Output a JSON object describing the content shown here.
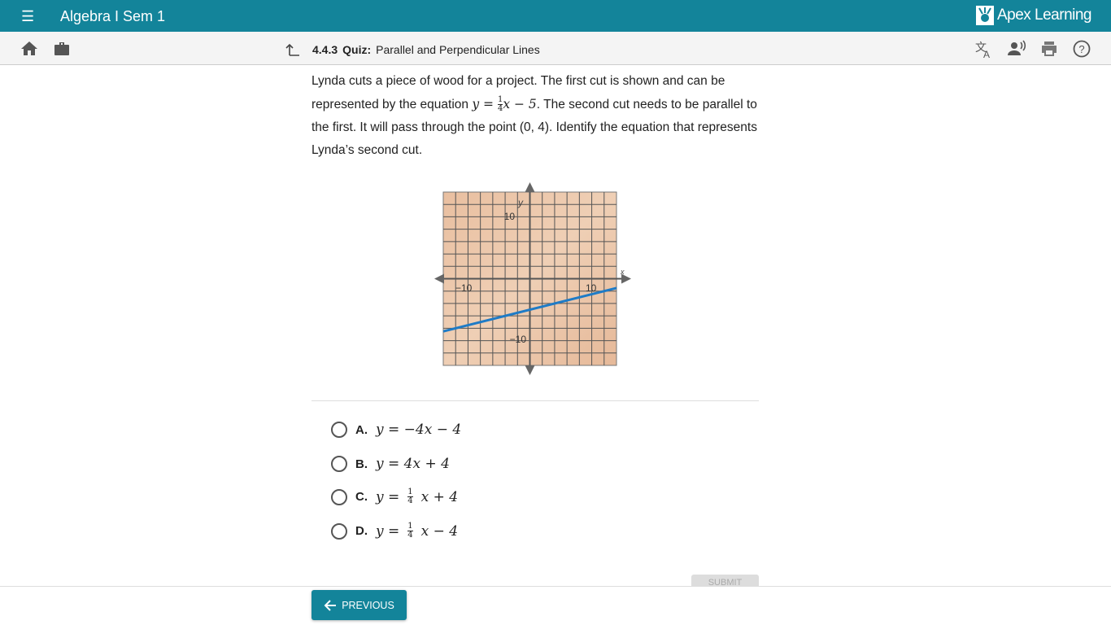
{
  "header": {
    "course_title": "Algebra I Sem 1",
    "brand": "Apex Learning",
    "brand_color": "#13849a"
  },
  "toolbar": {
    "lesson_number": "4.4.3",
    "lesson_type": "Quiz:",
    "lesson_title": "Parallel and Perpendicular Lines"
  },
  "question": {
    "part1": "Lynda cuts a piece of wood for a project. The first cut is shown and can be represented by the equation ",
    "eq_lhs": "y = ",
    "frac_num": "1",
    "frac_den": "4",
    "eq_rhs": "x − 5",
    "part2": ". The second cut needs to be parallel to the first. It will pass through the point (0, 4). Identify the equation that represents Lynda’s second cut."
  },
  "chart_data": {
    "type": "line",
    "xlabel": "x",
    "ylabel": "y",
    "xlim": [
      -14,
      14
    ],
    "ylim": [
      -14,
      14
    ],
    "grid": true,
    "grid_step": 2,
    "x_tick_labels": [
      "−10",
      "10"
    ],
    "y_tick_labels": [
      "10",
      "−10"
    ],
    "series": [
      {
        "equation": "y = 1/4 x − 5",
        "x": [
          -14,
          14
        ],
        "y": [
          -8.5,
          -1.5
        ],
        "color": "#1e7bc6"
      }
    ]
  },
  "options": [
    {
      "letter": "A.",
      "pre": "y = −4x − 4",
      "num": "",
      "den": "",
      "post": ""
    },
    {
      "letter": "B.",
      "pre": "y = 4x + 4",
      "num": "",
      "den": "",
      "post": ""
    },
    {
      "letter": "C.",
      "pre": "y = ",
      "num": "1",
      "den": "4",
      "post": "x + 4"
    },
    {
      "letter": "D.",
      "pre": "y = ",
      "num": "1",
      "den": "4",
      "post": "x − 4"
    }
  ],
  "buttons": {
    "previous": "PREVIOUS",
    "submit": "SUBMIT"
  }
}
